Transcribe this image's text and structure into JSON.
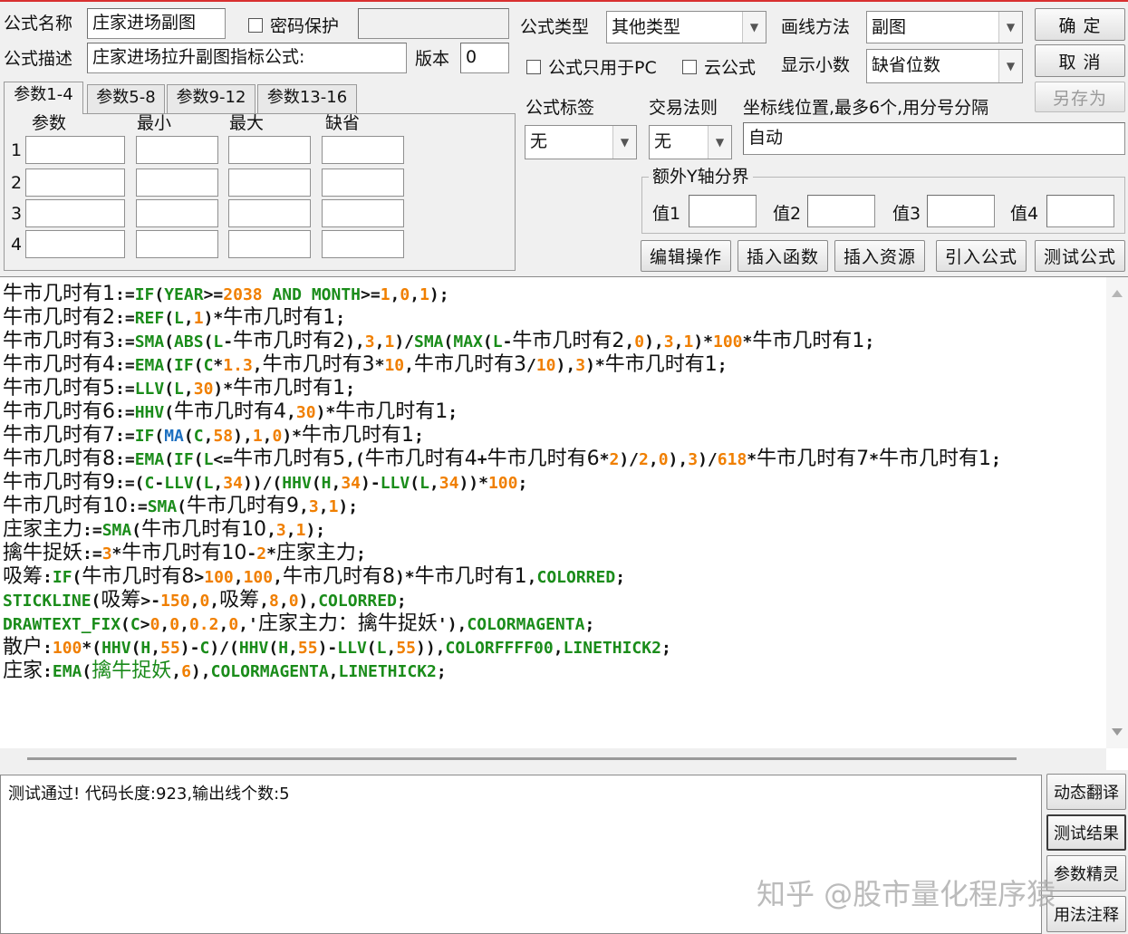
{
  "window": {
    "formula_name_label": "公式名称",
    "formula_name_value": "庄家进场副图",
    "password_label": "密码保护",
    "password_value": "",
    "formula_desc_label": "公式描述",
    "formula_desc_value": "庄家进场拉升副图指标公式:",
    "version_label": "版本",
    "version_value": "0",
    "formula_type_label": "公式类型",
    "formula_type_value": "其他类型",
    "draw_method_label": "画线方法",
    "draw_method_value": "副图",
    "pc_only_label": "公式只用于PC",
    "cloud_label": "云公式",
    "decimal_label": "显示小数",
    "decimal_value": "缺省位数",
    "ok_button": "确 定",
    "cancel_button": "取 消",
    "save_as_button": "另存为",
    "formula_tag_label": "公式标签",
    "formula_tag_value": "无",
    "trade_rule_label": "交易法则",
    "trade_rule_value": "无",
    "axis_label": "坐标线位置,最多6个,用分号分隔",
    "axis_value": "自动",
    "y_group_title": "额外Y轴分界",
    "y_values": [
      "值1",
      "值2",
      "值3",
      "值4"
    ],
    "action_buttons": [
      "编辑操作",
      "插入函数",
      "插入资源",
      "引入公式",
      "测试公式"
    ]
  },
  "params": {
    "tabs": [
      "参数1-4",
      "参数5-8",
      "参数9-12",
      "参数13-16"
    ],
    "headers": [
      "参数",
      "最小",
      "最大",
      "缺省"
    ],
    "rows": [
      "1",
      "2",
      "3",
      "4"
    ]
  },
  "output": {
    "text": "测试通过! 代码长度:923,输出线个数:5"
  },
  "side_buttons": [
    "动态翻译",
    "测试结果",
    "参数精灵",
    "用法注释"
  ],
  "watermark": "知乎 @股市量化程序猿",
  "colors": {
    "keyword": "#1a8c1a",
    "number": "#f07f00",
    "highlight_func": "#1c6fc0",
    "top_border": "#d83030"
  },
  "code_lines": [
    [
      [
        "c",
        "牛市几时有1"
      ],
      [
        "t",
        ":="
      ],
      [
        "f",
        "IF"
      ],
      [
        "t",
        "("
      ],
      [
        "f",
        "YEAR"
      ],
      [
        "t",
        ">="
      ],
      [
        "n",
        "2038"
      ],
      [
        "f",
        " AND "
      ],
      [
        "f",
        "MONTH"
      ],
      [
        "t",
        ">="
      ],
      [
        "n",
        "1"
      ],
      [
        "t",
        ","
      ],
      [
        "n",
        "0"
      ],
      [
        "t",
        ","
      ],
      [
        "n",
        "1"
      ],
      [
        "t",
        ");"
      ]
    ],
    [
      [
        "c",
        "牛市几时有2"
      ],
      [
        "t",
        ":="
      ],
      [
        "f",
        "REF"
      ],
      [
        "t",
        "("
      ],
      [
        "f",
        "L"
      ],
      [
        "t",
        ","
      ],
      [
        "n",
        "1"
      ],
      [
        "t",
        ")*"
      ],
      [
        "c",
        "牛市几时有1"
      ],
      [
        "t",
        ";"
      ]
    ],
    [
      [
        "c",
        "牛市几时有3"
      ],
      [
        "t",
        ":="
      ],
      [
        "f",
        "SMA"
      ],
      [
        "t",
        "("
      ],
      [
        "f",
        "ABS"
      ],
      [
        "t",
        "("
      ],
      [
        "f",
        "L"
      ],
      [
        "t",
        "-"
      ],
      [
        "c",
        "牛市几时有2"
      ],
      [
        "t",
        "),"
      ],
      [
        "n",
        "3"
      ],
      [
        "t",
        ","
      ],
      [
        "n",
        "1"
      ],
      [
        "t",
        ")/"
      ],
      [
        "f",
        "SMA"
      ],
      [
        "t",
        "("
      ],
      [
        "f",
        "MAX"
      ],
      [
        "t",
        "("
      ],
      [
        "f",
        "L"
      ],
      [
        "t",
        "-"
      ],
      [
        "c",
        "牛市几时有2"
      ],
      [
        "t",
        ","
      ],
      [
        "n",
        "0"
      ],
      [
        "t",
        "),"
      ],
      [
        "n",
        "3"
      ],
      [
        "t",
        ","
      ],
      [
        "n",
        "1"
      ],
      [
        "t",
        ")*"
      ],
      [
        "n",
        "100"
      ],
      [
        "t",
        "*"
      ],
      [
        "c",
        "牛市几时有1"
      ],
      [
        "t",
        ";"
      ]
    ],
    [
      [
        "c",
        "牛市几时有4"
      ],
      [
        "t",
        ":="
      ],
      [
        "f",
        "EMA"
      ],
      [
        "t",
        "("
      ],
      [
        "f",
        "IF"
      ],
      [
        "t",
        "("
      ],
      [
        "f",
        "C"
      ],
      [
        "t",
        "*"
      ],
      [
        "n",
        "1.3"
      ],
      [
        "t",
        ","
      ],
      [
        "c",
        "牛市几时有3"
      ],
      [
        "t",
        "*"
      ],
      [
        "n",
        "10"
      ],
      [
        "t",
        ","
      ],
      [
        "c",
        "牛市几时有3"
      ],
      [
        "t",
        "/"
      ],
      [
        "n",
        "10"
      ],
      [
        "t",
        "),"
      ],
      [
        "n",
        "3"
      ],
      [
        "t",
        ")*"
      ],
      [
        "c",
        "牛市几时有1"
      ],
      [
        "t",
        ";"
      ]
    ],
    [
      [
        "c",
        "牛市几时有5"
      ],
      [
        "t",
        ":="
      ],
      [
        "f",
        "LLV"
      ],
      [
        "t",
        "("
      ],
      [
        "f",
        "L"
      ],
      [
        "t",
        ","
      ],
      [
        "n",
        "30"
      ],
      [
        "t",
        ")*"
      ],
      [
        "c",
        "牛市几时有1"
      ],
      [
        "t",
        ";"
      ]
    ],
    [
      [
        "c",
        "牛市几时有6"
      ],
      [
        "t",
        ":="
      ],
      [
        "f",
        "HHV"
      ],
      [
        "t",
        "("
      ],
      [
        "c",
        "牛市几时有4"
      ],
      [
        "t",
        ","
      ],
      [
        "n",
        "30"
      ],
      [
        "t",
        ")*"
      ],
      [
        "c",
        "牛市几时有1"
      ],
      [
        "t",
        ";"
      ]
    ],
    [
      [
        "c",
        "牛市几时有7"
      ],
      [
        "t",
        ":="
      ],
      [
        "f",
        "IF"
      ],
      [
        "t",
        "("
      ],
      [
        "b",
        "MA"
      ],
      [
        "t",
        "("
      ],
      [
        "f",
        "C"
      ],
      [
        "t",
        ","
      ],
      [
        "n",
        "58"
      ],
      [
        "t",
        "),"
      ],
      [
        "n",
        "1"
      ],
      [
        "t",
        ","
      ],
      [
        "n",
        "0"
      ],
      [
        "t",
        ")*"
      ],
      [
        "c",
        "牛市几时有1"
      ],
      [
        "t",
        ";"
      ]
    ],
    [
      [
        "c",
        "牛市几时有8"
      ],
      [
        "t",
        ":="
      ],
      [
        "f",
        "EMA"
      ],
      [
        "t",
        "("
      ],
      [
        "f",
        "IF"
      ],
      [
        "t",
        "("
      ],
      [
        "f",
        "L"
      ],
      [
        "t",
        "<="
      ],
      [
        "c",
        "牛市几时有5"
      ],
      [
        "t",
        ",("
      ],
      [
        "c",
        "牛市几时有4"
      ],
      [
        "t",
        "+"
      ],
      [
        "c",
        "牛市几时有6"
      ],
      [
        "t",
        "*"
      ],
      [
        "n",
        "2"
      ],
      [
        "t",
        ")/"
      ],
      [
        "n",
        "2"
      ],
      [
        "t",
        ","
      ],
      [
        "n",
        "0"
      ],
      [
        "t",
        "),"
      ],
      [
        "n",
        "3"
      ],
      [
        "t",
        ")/"
      ],
      [
        "n",
        "618"
      ],
      [
        "t",
        "*"
      ],
      [
        "c",
        "牛市几时有7"
      ],
      [
        "t",
        "*"
      ],
      [
        "c",
        "牛市几时有1"
      ],
      [
        "t",
        ";"
      ]
    ],
    [
      [
        "c",
        "牛市几时有9"
      ],
      [
        "t",
        ":=("
      ],
      [
        "f",
        "C"
      ],
      [
        "t",
        "-"
      ],
      [
        "f",
        "LLV"
      ],
      [
        "t",
        "("
      ],
      [
        "f",
        "L"
      ],
      [
        "t",
        ","
      ],
      [
        "n",
        "34"
      ],
      [
        "t",
        "))/("
      ],
      [
        "f",
        "HHV"
      ],
      [
        "t",
        "("
      ],
      [
        "f",
        "H"
      ],
      [
        "t",
        ","
      ],
      [
        "n",
        "34"
      ],
      [
        "t",
        ")-"
      ],
      [
        "f",
        "LLV"
      ],
      [
        "t",
        "("
      ],
      [
        "f",
        "L"
      ],
      [
        "t",
        ","
      ],
      [
        "n",
        "34"
      ],
      [
        "t",
        "))*"
      ],
      [
        "n",
        "100"
      ],
      [
        "t",
        ";"
      ]
    ],
    [
      [
        "c",
        "牛市几时有10"
      ],
      [
        "t",
        ":="
      ],
      [
        "f",
        "SMA"
      ],
      [
        "t",
        "("
      ],
      [
        "c",
        "牛市几时有9"
      ],
      [
        "t",
        ","
      ],
      [
        "n",
        "3"
      ],
      [
        "t",
        ","
      ],
      [
        "n",
        "1"
      ],
      [
        "t",
        ");"
      ]
    ],
    [
      [
        "c",
        "庄家主力"
      ],
      [
        "t",
        ":="
      ],
      [
        "f",
        "SMA"
      ],
      [
        "t",
        "("
      ],
      [
        "c",
        "牛市几时有10"
      ],
      [
        "t",
        ","
      ],
      [
        "n",
        "3"
      ],
      [
        "t",
        ","
      ],
      [
        "n",
        "1"
      ],
      [
        "t",
        ");"
      ]
    ],
    [
      [
        "c",
        "擒牛捉妖"
      ],
      [
        "t",
        ":="
      ],
      [
        "n",
        "3"
      ],
      [
        "t",
        "*"
      ],
      [
        "c",
        "牛市几时有10"
      ],
      [
        "t",
        "-"
      ],
      [
        "n",
        "2"
      ],
      [
        "t",
        "*"
      ],
      [
        "c",
        "庄家主力"
      ],
      [
        "t",
        ";"
      ]
    ],
    [
      [
        "c",
        "吸筹"
      ],
      [
        "t",
        ":"
      ],
      [
        "f",
        "IF"
      ],
      [
        "t",
        "("
      ],
      [
        "c",
        "牛市几时有8"
      ],
      [
        "t",
        ">"
      ],
      [
        "n",
        "100"
      ],
      [
        "t",
        ","
      ],
      [
        "n",
        "100"
      ],
      [
        "t",
        ","
      ],
      [
        "c",
        "牛市几时有8"
      ],
      [
        "t",
        ")*"
      ],
      [
        "c",
        "牛市几时有1"
      ],
      [
        "t",
        ","
      ],
      [
        "f",
        "COLORRED"
      ],
      [
        "t",
        ";"
      ]
    ],
    [
      [
        "f",
        "STICKLINE"
      ],
      [
        "t",
        "("
      ],
      [
        "c",
        "吸筹"
      ],
      [
        "t",
        ">-"
      ],
      [
        "n",
        "150"
      ],
      [
        "t",
        ","
      ],
      [
        "n",
        "0"
      ],
      [
        "t",
        ","
      ],
      [
        "c",
        "吸筹"
      ],
      [
        "t",
        ","
      ],
      [
        "n",
        "8"
      ],
      [
        "t",
        ","
      ],
      [
        "n",
        "0"
      ],
      [
        "t",
        "),"
      ],
      [
        "f",
        "COLORRED"
      ],
      [
        "t",
        ";"
      ]
    ],
    [
      [
        "f",
        "DRAWTEXT_FIX"
      ],
      [
        "t",
        "("
      ],
      [
        "f",
        "C"
      ],
      [
        "t",
        ">"
      ],
      [
        "n",
        "0"
      ],
      [
        "t",
        ","
      ],
      [
        "n",
        "0"
      ],
      [
        "t",
        ","
      ],
      [
        "n",
        "0.2"
      ],
      [
        "t",
        ","
      ],
      [
        "n",
        "0"
      ],
      [
        "t",
        ",'"
      ],
      [
        "c",
        "庄家主力："
      ],
      [
        "c",
        "擒牛捉妖"
      ],
      [
        "t",
        "'),"
      ],
      [
        "f",
        "COLORMAGENTA"
      ],
      [
        "t",
        ";"
      ]
    ],
    [
      [
        "c",
        "散户"
      ],
      [
        "t",
        ":"
      ],
      [
        "n",
        "100"
      ],
      [
        "t",
        "*("
      ],
      [
        "f",
        "HHV"
      ],
      [
        "t",
        "("
      ],
      [
        "f",
        "H"
      ],
      [
        "t",
        ","
      ],
      [
        "n",
        "55"
      ],
      [
        "t",
        ")-"
      ],
      [
        "f",
        "C"
      ],
      [
        "t",
        ")/("
      ],
      [
        "f",
        "HHV"
      ],
      [
        "t",
        "("
      ],
      [
        "f",
        "H"
      ],
      [
        "t",
        ","
      ],
      [
        "n",
        "55"
      ],
      [
        "t",
        ")-"
      ],
      [
        "f",
        "LLV"
      ],
      [
        "t",
        "("
      ],
      [
        "f",
        "L"
      ],
      [
        "t",
        ","
      ],
      [
        "n",
        "55"
      ],
      [
        "t",
        ")),"
      ],
      [
        "f",
        "COLORFFFF00"
      ],
      [
        "t",
        ","
      ],
      [
        "f",
        "LINETHICK2"
      ],
      [
        "t",
        ";"
      ]
    ],
    [
      [
        "c",
        "庄家"
      ],
      [
        "t",
        ":"
      ],
      [
        "f",
        "EMA"
      ],
      [
        "t",
        "("
      ],
      [
        "cg",
        "擒牛捉妖"
      ],
      [
        "t",
        ","
      ],
      [
        "n",
        "6"
      ],
      [
        "t",
        "),"
      ],
      [
        "f",
        "COLORMAGENTA"
      ],
      [
        "t",
        ","
      ],
      [
        "f",
        "LINETHICK2"
      ],
      [
        "t",
        ";"
      ]
    ]
  ]
}
